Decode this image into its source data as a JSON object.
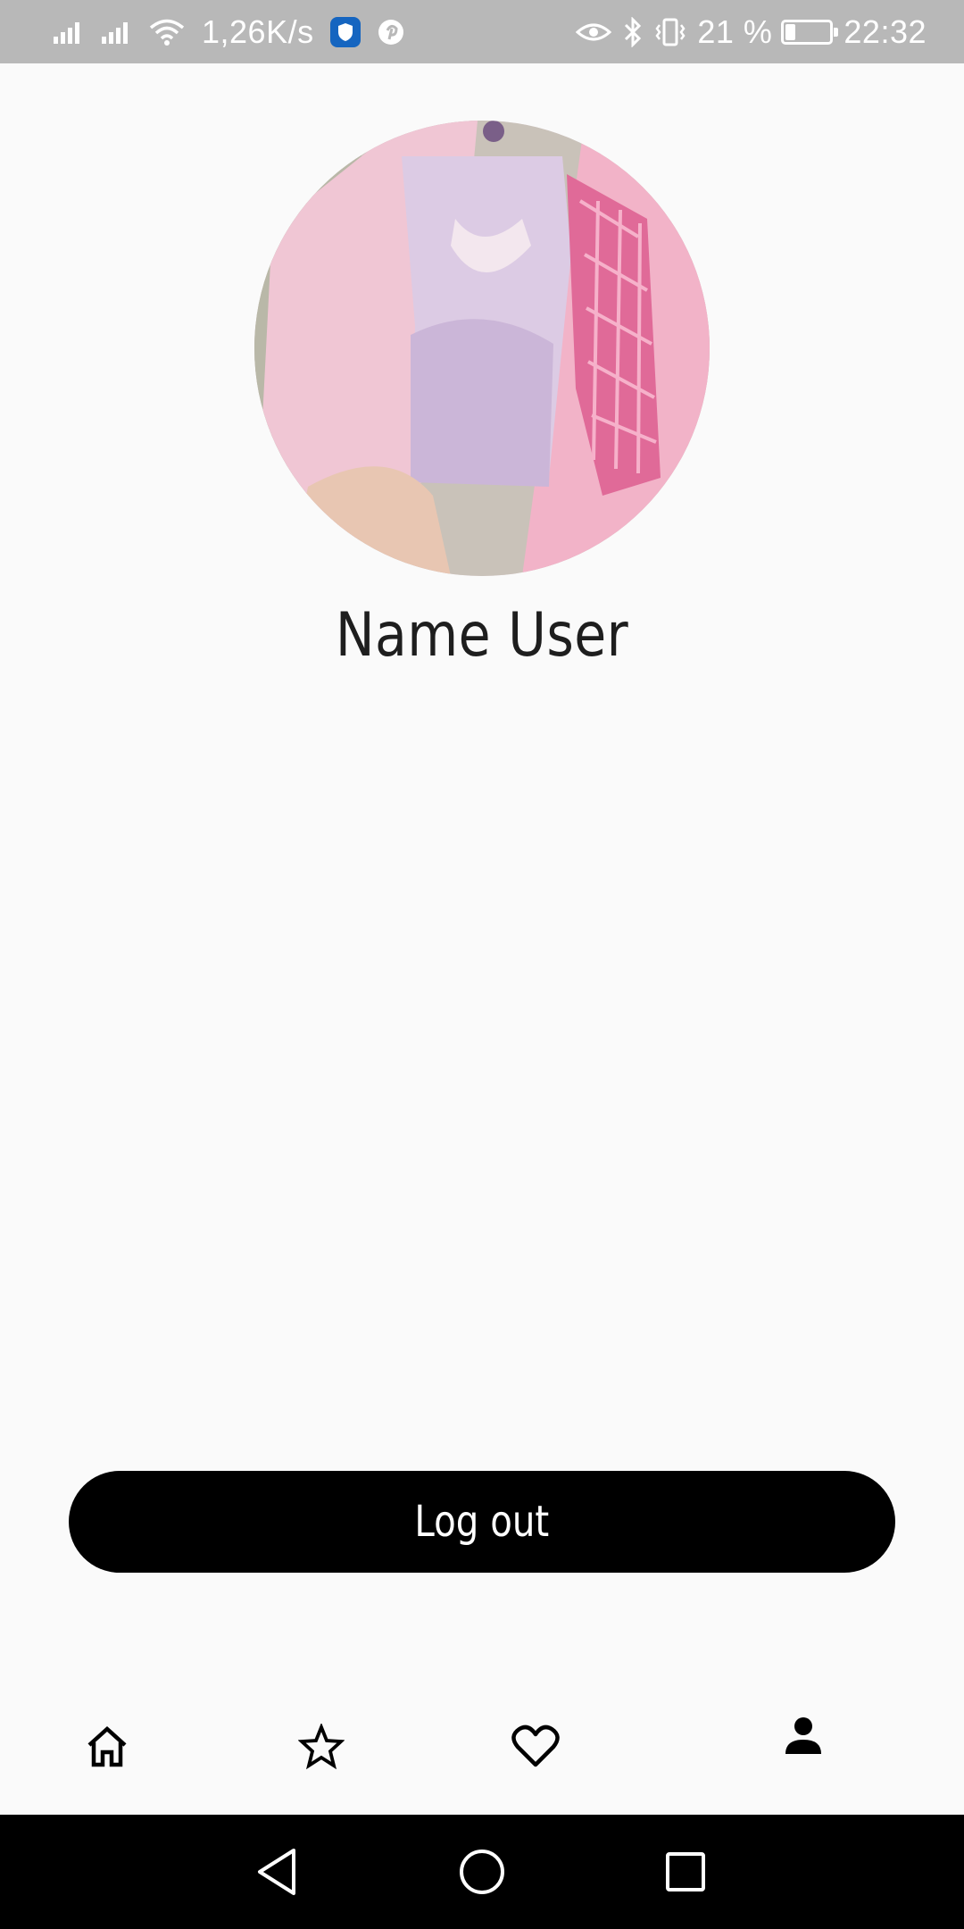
{
  "status_bar": {
    "network_speed": "1,26K/s",
    "battery_percent": "21 %",
    "battery_level": 0.21,
    "time": "22:32",
    "icons": [
      "signal-icon",
      "signal-icon",
      "wifi-icon",
      "shield-icon",
      "pinterest-icon",
      "eye-icon",
      "bluetooth-icon",
      "vibrate-icon",
      "battery-icon"
    ]
  },
  "profile": {
    "user_name": "Name User",
    "avatar": "avatar-photo"
  },
  "actions": {
    "logout_label": "Log out"
  },
  "bottom_nav": {
    "items": [
      {
        "icon": "home-icon",
        "active": false
      },
      {
        "icon": "star-icon",
        "active": false
      },
      {
        "icon": "heart-icon",
        "active": false
      },
      {
        "icon": "person-icon",
        "active": true
      }
    ]
  },
  "system_nav": {
    "icons": [
      "back-icon",
      "home-circle-icon",
      "recents-icon"
    ]
  },
  "colors": {
    "status_bar": "#b8b8b8",
    "background": "#fafafa",
    "button": "#000000",
    "button_text": "#ffffff",
    "shield": "#1565c0"
  }
}
